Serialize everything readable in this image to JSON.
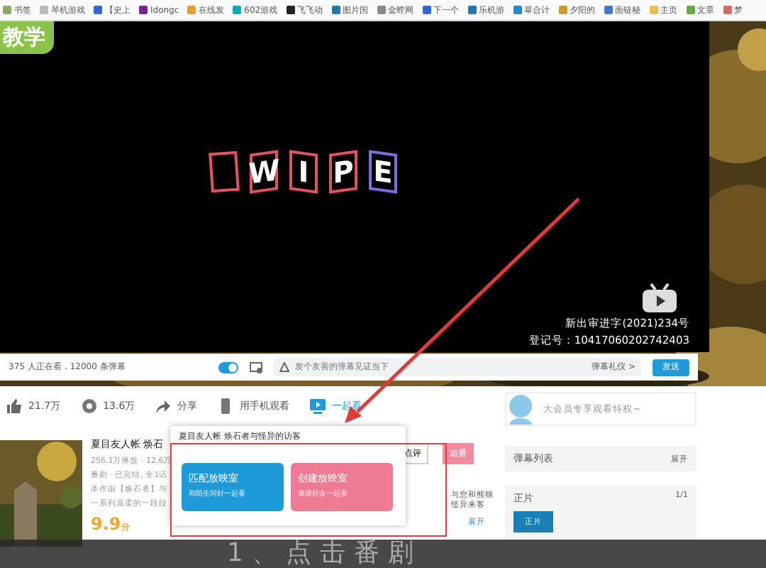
{
  "bookmarks": [
    {
      "label": "书签"
    },
    {
      "label": "琴机游戏"
    },
    {
      "label": "【史上"
    },
    {
      "label": "Idongc"
    },
    {
      "label": "在线发"
    },
    {
      "label": "602游戏"
    },
    {
      "label": "飞飞动"
    },
    {
      "label": "图片国"
    },
    {
      "label": "金螳网"
    },
    {
      "label": "下一个"
    },
    {
      "label": "乐机游"
    },
    {
      "label": "草合计"
    },
    {
      "label": "夕阳的"
    },
    {
      "label": "面链秘"
    },
    {
      "label": "主页"
    },
    {
      "label": "文章"
    },
    {
      "label": "梦"
    }
  ],
  "logo": {
    "text": "教学"
  },
  "video": {
    "effect_letters": [
      "W",
      "I",
      "P",
      "E"
    ],
    "license": "新出审进字(2021)234号",
    "registration": "登记号：10417060202742403"
  },
  "controls": {
    "viewers": "375 人正在看，12000 条弹幕",
    "danmaku_on": true,
    "placeholder": "发个友善的弹幕见证当下",
    "etiquette": "弹幕礼仪 >",
    "send": "发送"
  },
  "actions": [
    {
      "kind": "like",
      "label": "21.7万"
    },
    {
      "kind": "coin",
      "label": "13.6万"
    },
    {
      "kind": "share",
      "label": "分享"
    },
    {
      "kind": "phone",
      "label": "用手机观看"
    },
    {
      "kind": "watch",
      "label": "一起看"
    }
  ],
  "vip_prompt": "大会员专享观看特权~",
  "info": {
    "title": "夏目友人帐 焕石",
    "stats": "256.1万播放 · 12.6万",
    "meta": "番剧 · 已完结, 全1话",
    "desc_1": "本作由【焕石者】与",
    "desc_2": "一系列温柔的一段段",
    "desc_right": "与您和熊猫怪异来客",
    "expand": "展开",
    "score": "9.9",
    "score_unit": "分",
    "review": "点评",
    "follow": "追番"
  },
  "popup": {
    "title": "夏目友人帐 焕石者与怪异的访客",
    "options": [
      {
        "title": "匹配放映室",
        "subtitle": "和陌生同好一起看",
        "color": "#1e9bd8"
      },
      {
        "title": "创建放映室",
        "subtitle": "邀请好友一起看",
        "color": "#ee7b93"
      }
    ]
  },
  "side": {
    "danmaku_list": "弹幕列表",
    "danmaku_expand": "展开",
    "episodes": "正片",
    "episode_count": "1/1",
    "episode_thumb": "正片"
  },
  "caption": "1、点击番剧"
}
